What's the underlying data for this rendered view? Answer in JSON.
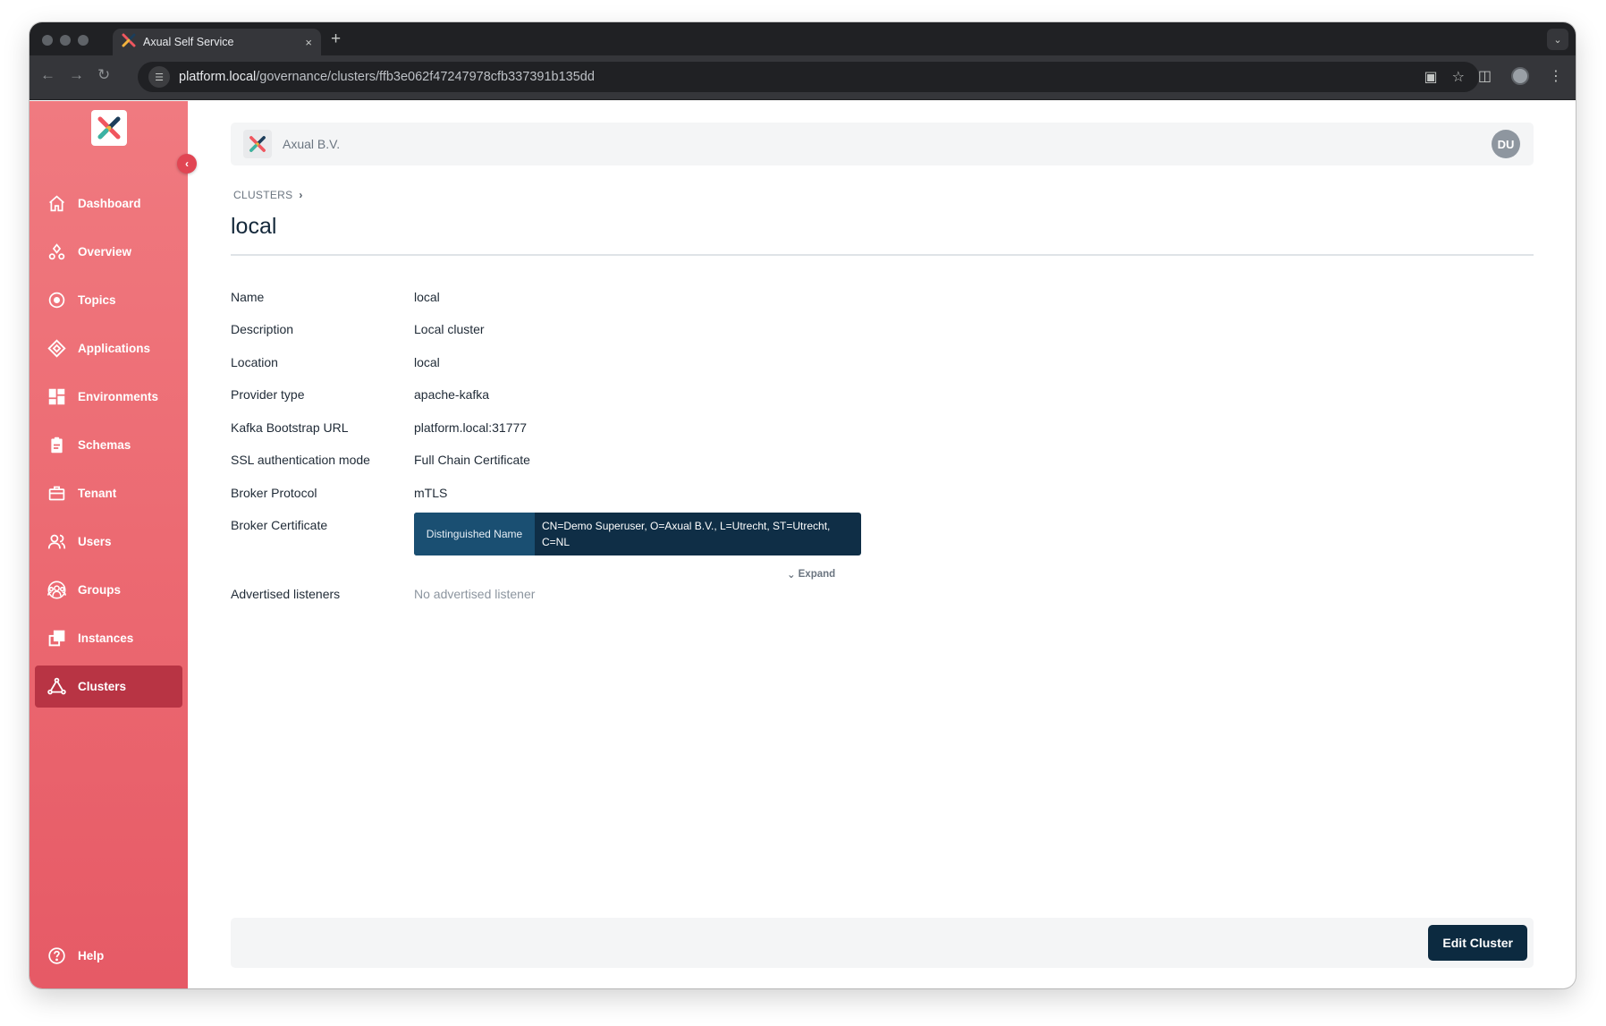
{
  "browser": {
    "tab_title": "Axual Self Service",
    "tab_close": "×",
    "new_tab": "+",
    "url_domain": "platform.local",
    "url_path": "/governance/clusters/ffb3e062f47247978cfb337391b135dd"
  },
  "sidebar": {
    "items": [
      {
        "label": "Dashboard",
        "icon": "home-icon"
      },
      {
        "label": "Overview",
        "icon": "overview-icon"
      },
      {
        "label": "Topics",
        "icon": "topics-icon"
      },
      {
        "label": "Applications",
        "icon": "applications-icon"
      },
      {
        "label": "Environments",
        "icon": "environments-icon"
      },
      {
        "label": "Schemas",
        "icon": "schemas-icon"
      },
      {
        "label": "Tenant",
        "icon": "tenant-icon"
      },
      {
        "label": "Users",
        "icon": "users-icon"
      },
      {
        "label": "Groups",
        "icon": "groups-icon"
      },
      {
        "label": "Instances",
        "icon": "instances-icon"
      },
      {
        "label": "Clusters",
        "icon": "clusters-icon",
        "active": true
      }
    ],
    "help_label": "Help",
    "accent": "#ec6a72",
    "active_bg": "#b83444"
  },
  "header": {
    "org_name": "Axual B.V.",
    "avatar_initials": "DU"
  },
  "breadcrumb": {
    "parent": "CLUSTERS"
  },
  "page": {
    "title": "local"
  },
  "details": {
    "rows": [
      {
        "label": "Name",
        "value": "local"
      },
      {
        "label": "Description",
        "value": "Local cluster"
      },
      {
        "label": "Location",
        "value": "local"
      },
      {
        "label": "Provider type",
        "value": "apache-kafka"
      },
      {
        "label": "Kafka Bootstrap URL",
        "value": "platform.local:31777"
      },
      {
        "label": "SSL authentication mode",
        "value": "Full Chain Certificate"
      },
      {
        "label": "Broker Protocol",
        "value": "mTLS"
      }
    ],
    "broker_certificate": {
      "label": "Broker Certificate",
      "key": "Distinguished Name",
      "value": "CN=Demo Superuser, O=Axual B.V., L=Utrecht, ST=Utrecht, C=NL",
      "expand_label": "Expand"
    },
    "advertised_listeners": {
      "label": "Advertised listeners",
      "value": "No advertised listener"
    }
  },
  "footer": {
    "edit_label": "Edit Cluster"
  }
}
